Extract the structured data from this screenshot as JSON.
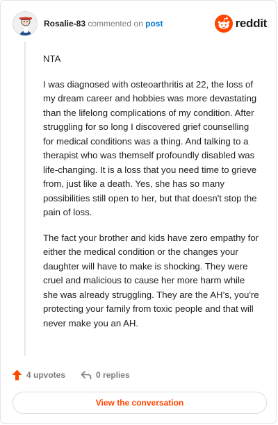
{
  "header": {
    "username": "Rosalie-83",
    "action_text": "commented on",
    "post_link": "post",
    "brand": "reddit"
  },
  "comment": {
    "paragraphs": [
      "NTA",
      "I was diagnosed with osteoarthritis at 22, the loss of my dream career and hobbies was more devastating than the lifelong complications of my condition. After struggling for so long I discovered grief counselling for medical conditions was a thing. And talking to a therapist who was themself profoundly disabled was life-changing. It is a loss that you need time to grieve from, just like a death. Yes, she has so many possibilities still open to her, but that doesn't stop the pain of loss.",
      "The fact your brother and kids have zero empathy for either the medical condition or the changes your daughter will have to make is shocking. They were cruel and malicious to cause her more harm while she was already struggling. They are the AH’s, you're protecting your family from toxic people and that will never make you an AH."
    ]
  },
  "actions": {
    "upvotes": "4 upvotes",
    "replies": "0 replies"
  },
  "cta": {
    "label": "View the conversation"
  },
  "colors": {
    "accent": "#ff4500",
    "link": "#0079d3",
    "muted": "#7c7c7c",
    "text": "#1c1c1c"
  },
  "icons": [
    "user-avatar",
    "reddit-logo-icon",
    "upvote-arrow-icon",
    "reply-arrow-icon"
  ]
}
